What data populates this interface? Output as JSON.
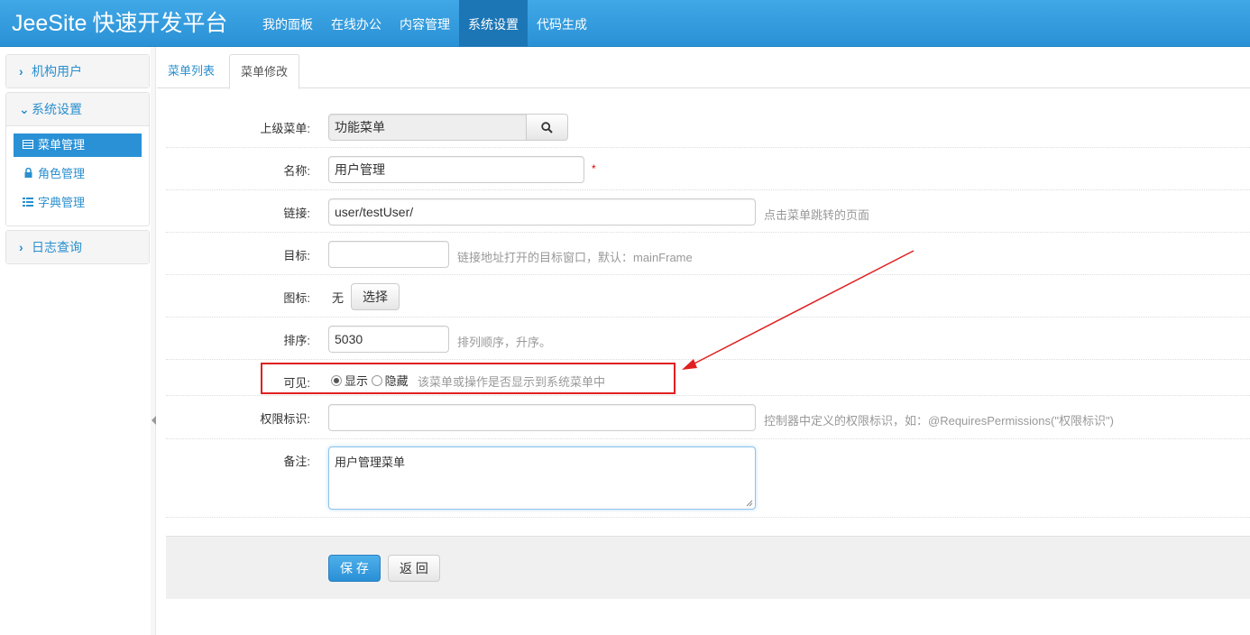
{
  "app": {
    "brand": "JeeSite",
    "brand_cn": "快速开发平台",
    "nav": [
      "我的面板",
      "在线办公",
      "内容管理",
      "系统设置",
      "代码生成"
    ],
    "nav_active": "系统设置"
  },
  "sidebar": {
    "groups": [
      {
        "label": "机构用户",
        "expanded": false
      },
      {
        "label": "系统设置",
        "expanded": true,
        "items": [
          {
            "label": "菜单管理",
            "icon": "table-icon",
            "active": true
          },
          {
            "label": "角色管理",
            "icon": "lock-icon",
            "active": false
          },
          {
            "label": "字典管理",
            "icon": "list-icon",
            "active": false
          }
        ]
      },
      {
        "label": "日志查询",
        "expanded": false
      }
    ]
  },
  "tabs": {
    "list": "菜单列表",
    "edit": "菜单修改"
  },
  "form": {
    "parent": {
      "label": "上级菜单:",
      "value": "功能菜单"
    },
    "name": {
      "label": "名称:",
      "value": "用户管理",
      "required": "*"
    },
    "href": {
      "label": "链接:",
      "value": "user/testUser/",
      "help": "点击菜单跳转的页面"
    },
    "target": {
      "label": "目标:",
      "value": "",
      "help": "链接地址打开的目标窗口，默认：mainFrame"
    },
    "icon": {
      "label": "图标:",
      "value": "无",
      "button": "选择"
    },
    "sort": {
      "label": "排序:",
      "value": "5030",
      "help": "排列顺序，升序。"
    },
    "show": {
      "label": "可见:",
      "option_show": "显示",
      "option_hide": "隐藏",
      "selected": "显示",
      "help": "该菜单或操作是否显示到系统菜单中"
    },
    "permission": {
      "label": "权限标识:",
      "value": "",
      "help": "控制器中定义的权限标识，如：@RequiresPermissions(\"权限标识\")"
    },
    "remarks": {
      "label": "备注:",
      "value": "用户管理菜单"
    }
  },
  "actions": {
    "save": "保 存",
    "back": "返 回"
  },
  "colors": {
    "navbar": "#2a91d6",
    "nav_active": "#1c76b6",
    "link": "#2a8fcf",
    "annotation": "#e02020"
  }
}
